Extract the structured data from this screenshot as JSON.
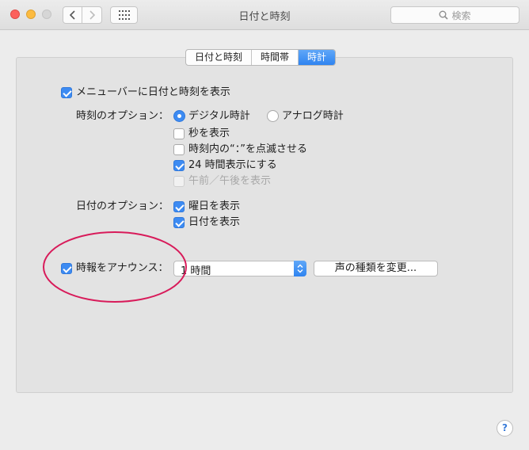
{
  "window": {
    "title": "日付と時刻",
    "search_placeholder": "検索"
  },
  "tabs": [
    {
      "label": "日付と時刻",
      "active": false
    },
    {
      "label": "時間帯",
      "active": false
    },
    {
      "label": "時計",
      "active": true
    }
  ],
  "clock": {
    "show_in_menubar": {
      "label": "メニューバーに日付と時刻を表示",
      "checked": true
    },
    "time_options_label": "時刻のオプション：",
    "digital": {
      "label": "デジタル時計",
      "selected": true
    },
    "analog": {
      "label": "アナログ時計",
      "selected": false
    },
    "show_seconds": {
      "label": "秒を表示",
      "checked": false
    },
    "flash_separators": {
      "label": "時刻内の“：”を点滅させる",
      "checked": false
    },
    "use_24h": {
      "label": "24 時間表示にする",
      "checked": true
    },
    "show_ampm": {
      "label": "午前／午後を表示",
      "checked": false,
      "disabled": true
    },
    "date_options_label": "日付のオプション：",
    "show_day_of_week": {
      "label": "曜日を表示",
      "checked": true
    },
    "show_date": {
      "label": "日付を表示",
      "checked": true
    },
    "announce": {
      "label": "時報をアナウンス：",
      "checked": true
    },
    "announce_interval": "1 時間",
    "customize_voice_button": "声の種類を変更..."
  },
  "help_button": "?",
  "colors": {
    "accent": "#3d8bf2",
    "annotation_circle": "#d81b5a"
  }
}
